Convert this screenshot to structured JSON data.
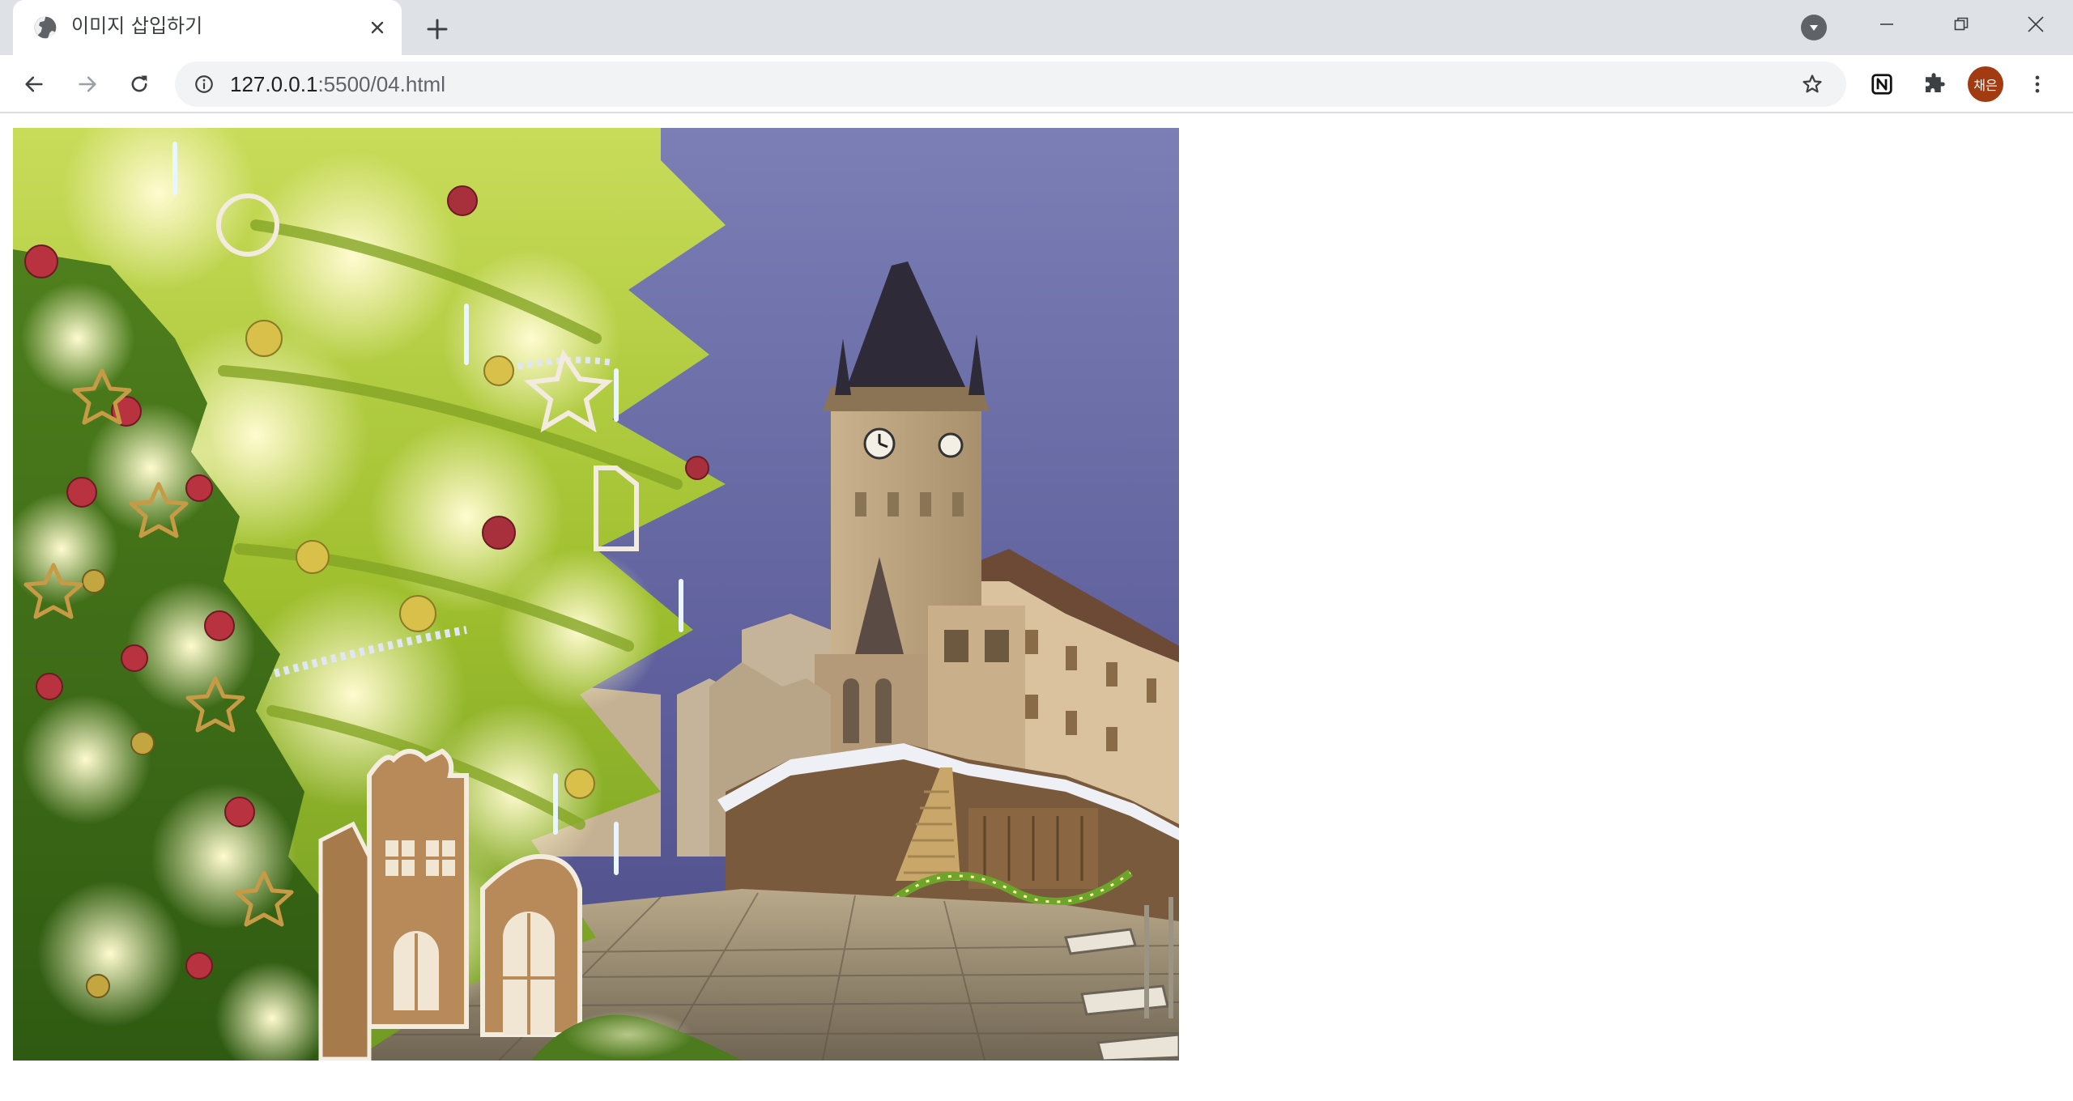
{
  "tab": {
    "title": "이미지 삽입하기",
    "favicon": "globe-icon",
    "close_icon": "close-icon"
  },
  "tabstrip": {
    "new_tab_icon": "plus-icon",
    "tab_search_icon": "chevron-down-icon"
  },
  "window_controls": [
    "minimize-icon",
    "restore-icon",
    "close-icon"
  ],
  "toolbar": {
    "back_icon": "arrow-left-icon",
    "forward_icon": "arrow-right-icon",
    "reload_icon": "reload-icon",
    "url_host": "127.0.0.1",
    "url_rest": ":5500/04.html",
    "site_info_icon": "info-icon",
    "bookmark_icon": "star-icon",
    "extensions": [
      "notion-icon",
      "puzzle-icon"
    ],
    "profile_label": "채은",
    "menu_icon": "more-vert-icon"
  },
  "page": {
    "image": {
      "description_name": "christmas-market-image",
      "subject": "Christmas tree with lights and clock tower at night"
    }
  },
  "colors": {
    "tabstrip_bg": "#dee1e6",
    "omnibox_bg": "#f1f3f4",
    "avatar_bg": "#a23a12",
    "icon": "#5f6368"
  }
}
